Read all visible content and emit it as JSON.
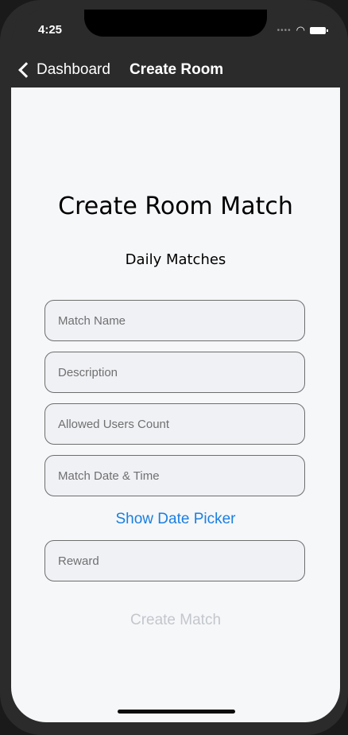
{
  "status": {
    "time": "4:25"
  },
  "nav": {
    "back_label": "Dashboard",
    "title": "Create Room"
  },
  "page": {
    "heading": "Create Room Match",
    "subheading": "Daily Matches"
  },
  "form": {
    "match_name": {
      "placeholder": "Match Name",
      "value": ""
    },
    "description": {
      "placeholder": "Description",
      "value": ""
    },
    "allowed_users": {
      "placeholder": "Allowed Users Count",
      "value": ""
    },
    "match_datetime": {
      "placeholder": "Match Date & Time",
      "value": ""
    },
    "reward": {
      "placeholder": "Reward",
      "value": ""
    },
    "show_date_picker": "Show Date Picker",
    "create_match": "Create Match"
  },
  "colors": {
    "accent": "#1a7fe0",
    "disabled": "#c3c6cc",
    "nav_bg": "#2b2b2b",
    "content_bg": "#f6f7f9"
  },
  "icons": [
    "chevron-left-icon",
    "wifi-icon",
    "battery-icon",
    "signal-icon"
  ]
}
